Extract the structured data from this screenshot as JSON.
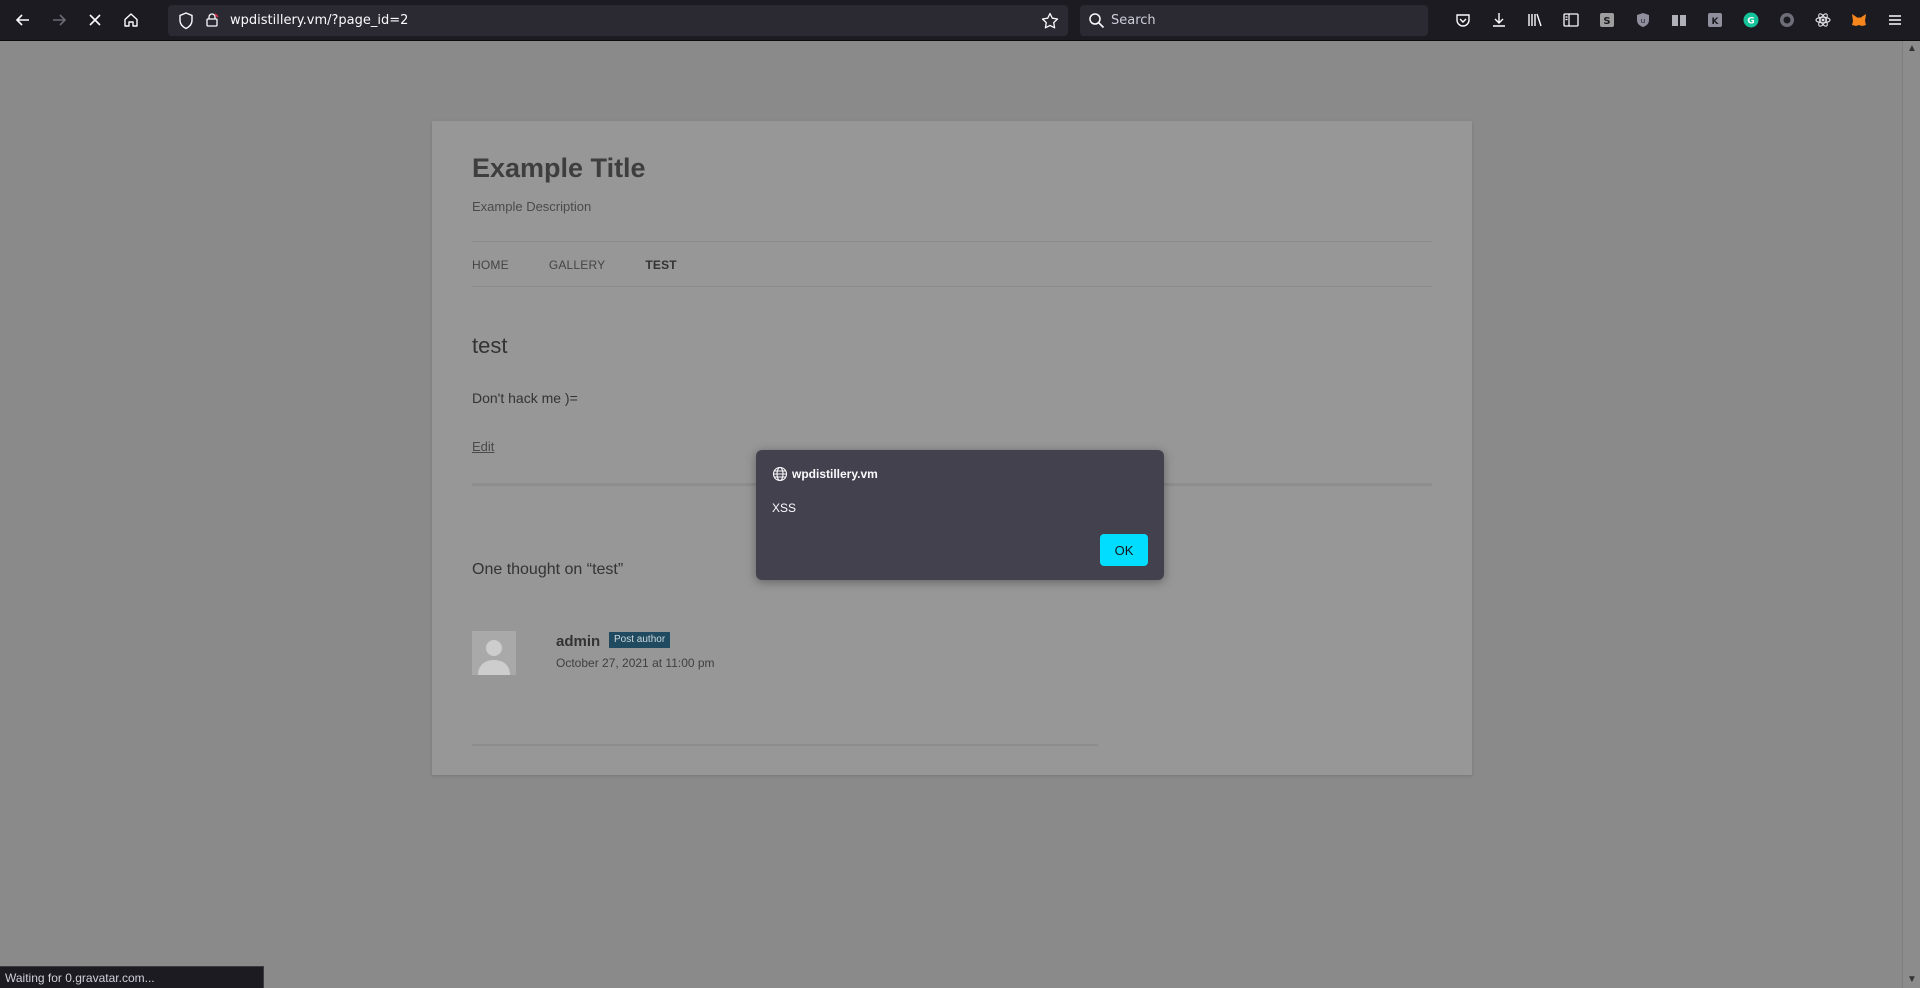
{
  "browser": {
    "url": "wpdistillery.vm/?page_id=2",
    "search_placeholder": "Search",
    "status_text": "Waiting for 0.gravatar.com..."
  },
  "site": {
    "title": "Example Title",
    "description": "Example Description",
    "nav": [
      {
        "label": "HOME"
      },
      {
        "label": "GALLERY"
      },
      {
        "label": "TEST"
      }
    ],
    "page_title": "test",
    "page_body": "Don't hack me )=",
    "edit_label": "Edit",
    "comments_title": "One thought on “test”",
    "comment": {
      "author": "admin",
      "badge": "Post author",
      "date": "October 27, 2021 at 11:00 pm"
    }
  },
  "dialog": {
    "origin": "wpdistillery.vm",
    "message": "XSS",
    "ok_label": "OK"
  },
  "colors": {
    "dialog_bg": "#42414d",
    "ok_button": "#00ddff",
    "toolbar_bg": "#1c1b22",
    "badge_bg": "#1f4a60"
  }
}
